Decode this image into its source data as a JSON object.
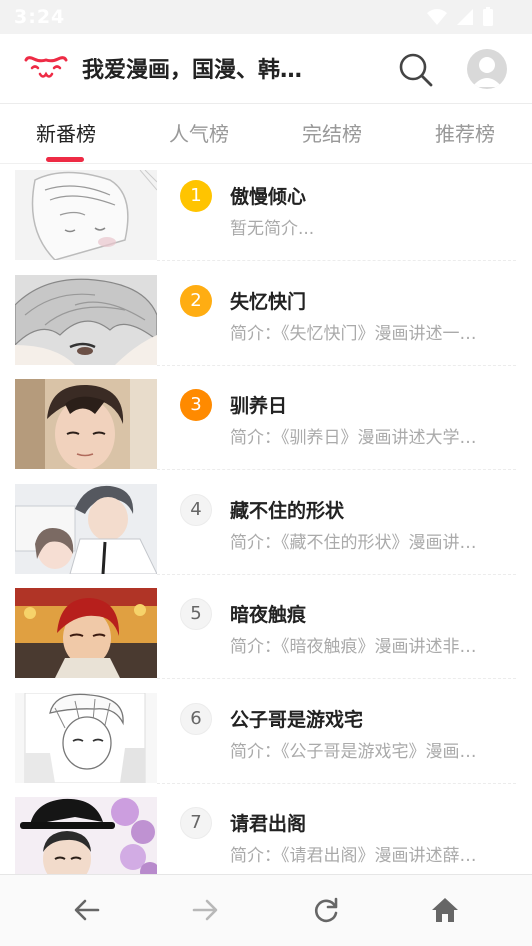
{
  "status_bar": {
    "time": "3:24",
    "icons": [
      "wifi-icon",
      "signal-icon",
      "battery-icon"
    ]
  },
  "header": {
    "logo_icon": "cat-face-logo",
    "title": "我爱漫画，国漫、韩…",
    "search_icon": "search-icon",
    "avatar_icon": "user-avatar-icon"
  },
  "tabs": [
    {
      "label": "新番榜",
      "active": true
    },
    {
      "label": "人气榜",
      "active": false
    },
    {
      "label": "完结榜",
      "active": false
    },
    {
      "label": "推荐榜",
      "active": false
    }
  ],
  "list": [
    {
      "rank": "1",
      "rank_color": "#ffc400",
      "title": "傲慢倾心",
      "desc": "暂无简介..."
    },
    {
      "rank": "2",
      "rank_color": "#ffad12",
      "title": "失忆快门",
      "desc": "简介：《失忆快门》漫画讲述一…"
    },
    {
      "rank": "3",
      "rank_color": "#ff8a00",
      "title": "驯养日",
      "desc": "简介：《驯养日》漫画讲述大学…"
    },
    {
      "rank": "4",
      "rank_color": "",
      "title": "藏不住的形状",
      "desc": "简介：《藏不住的形状》漫画讲…"
    },
    {
      "rank": "5",
      "rank_color": "",
      "title": "暗夜触痕",
      "desc": "简介：《暗夜触痕》漫画讲述非…"
    },
    {
      "rank": "6",
      "rank_color": "",
      "title": "公子哥是游戏宅",
      "desc": "简介：《公子哥是游戏宅》漫画…"
    },
    {
      "rank": "7",
      "rank_color": "",
      "title": "请君出阁",
      "desc": "简介：《请君出阁》漫画讲述薛…"
    }
  ],
  "bottom_nav": [
    "back-arrow-icon",
    "forward-arrow-icon",
    "refresh-icon",
    "home-icon"
  ],
  "colors": {
    "accent": "#ee2b45",
    "tab_inactive": "#999999",
    "desc_text": "#aaaaaa"
  }
}
